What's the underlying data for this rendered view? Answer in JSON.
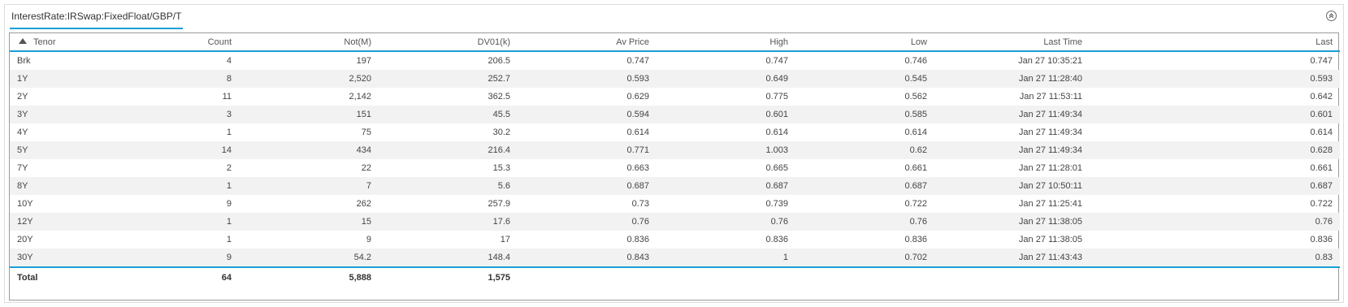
{
  "panel": {
    "title": "InterestRate:IRSwap:FixedFloat/GBP/T"
  },
  "table": {
    "columns": [
      "Tenor",
      "Count",
      "Not(M)",
      "DV01(k)",
      "Av Price",
      "High",
      "Low",
      "Last Time",
      "Last"
    ],
    "rows": [
      [
        "Brk",
        "4",
        "197",
        "206.5",
        "0.747",
        "0.747",
        "0.746",
        "Jan 27 10:35:21",
        "0.747"
      ],
      [
        "1Y",
        "8",
        "2,520",
        "252.7",
        "0.593",
        "0.649",
        "0.545",
        "Jan 27 11:28:40",
        "0.593"
      ],
      [
        "2Y",
        "11",
        "2,142",
        "362.5",
        "0.629",
        "0.775",
        "0.562",
        "Jan 27 11:53:11",
        "0.642"
      ],
      [
        "3Y",
        "3",
        "151",
        "45.5",
        "0.594",
        "0.601",
        "0.585",
        "Jan 27 11:49:34",
        "0.601"
      ],
      [
        "4Y",
        "1",
        "75",
        "30.2",
        "0.614",
        "0.614",
        "0.614",
        "Jan 27 11:49:34",
        "0.614"
      ],
      [
        "5Y",
        "14",
        "434",
        "216.4",
        "0.771",
        "1.003",
        "0.62",
        "Jan 27 11:49:34",
        "0.628"
      ],
      [
        "7Y",
        "2",
        "22",
        "15.3",
        "0.663",
        "0.665",
        "0.661",
        "Jan 27 11:28:01",
        "0.661"
      ],
      [
        "8Y",
        "1",
        "7",
        "5.6",
        "0.687",
        "0.687",
        "0.687",
        "Jan 27 10:50:11",
        "0.687"
      ],
      [
        "10Y",
        "9",
        "262",
        "257.9",
        "0.73",
        "0.739",
        "0.722",
        "Jan 27 11:25:41",
        "0.722"
      ],
      [
        "12Y",
        "1",
        "15",
        "17.6",
        "0.76",
        "0.76",
        "0.76",
        "Jan 27 11:38:05",
        "0.76"
      ],
      [
        "20Y",
        "1",
        "9",
        "17",
        "0.836",
        "0.836",
        "0.836",
        "Jan 27 11:38:05",
        "0.836"
      ],
      [
        "30Y",
        "9",
        "54.2",
        "148.4",
        "0.843",
        "1",
        "0.702",
        "Jan 27 11:43:43",
        "0.83"
      ]
    ],
    "total": {
      "label": "Total",
      "count": "64",
      "notional": "5,888",
      "dv01": "1,575"
    }
  },
  "icons": {
    "sort": "sort-ascending-icon",
    "collapse": "collapse-up-icon"
  },
  "colors": {
    "accent": "#1a9ed8",
    "stripe": "#f2f2f2"
  }
}
